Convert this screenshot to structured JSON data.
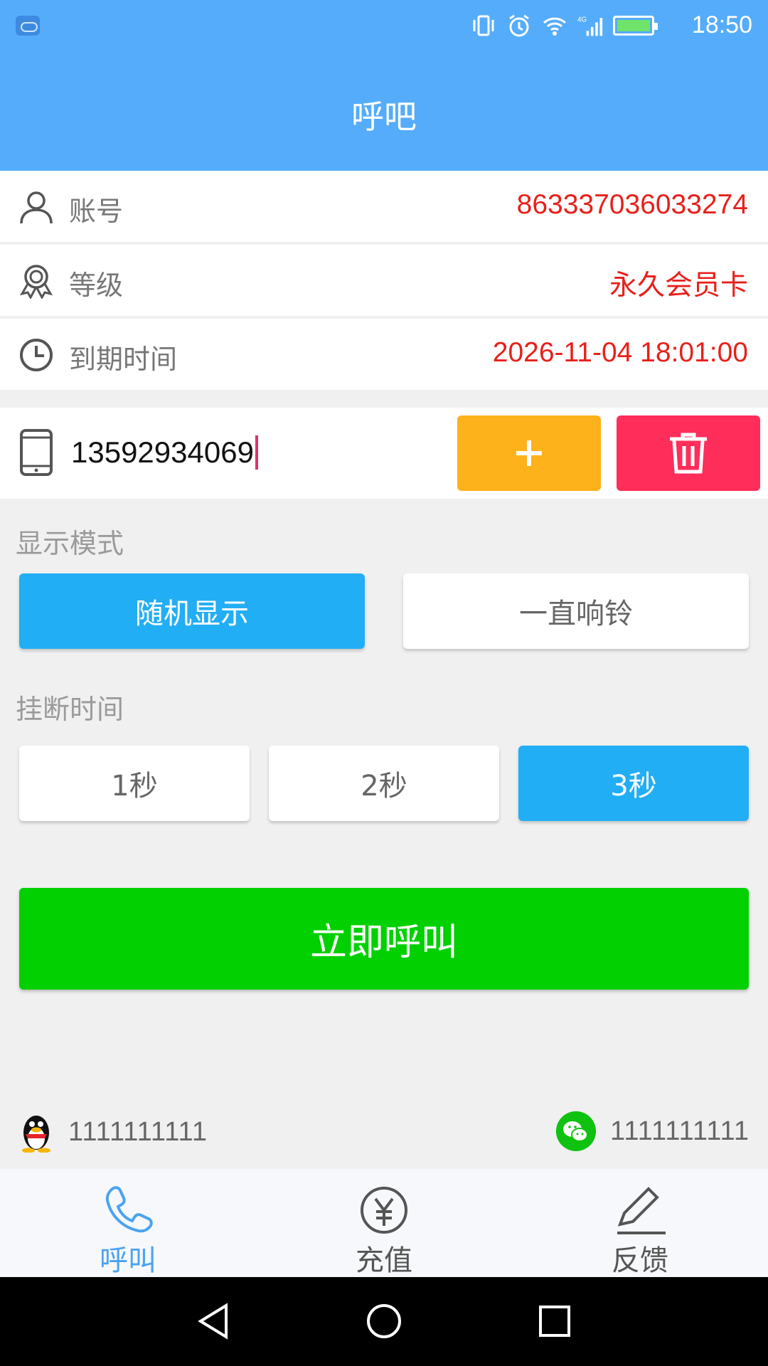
{
  "status_bar": {
    "time": "18:50",
    "network": "4G"
  },
  "header": {
    "title": "呼吧"
  },
  "info": {
    "account": {
      "label": "账号",
      "value": "863337036033274"
    },
    "level": {
      "label": "等级",
      "value": "永久会员卡"
    },
    "expiry": {
      "label": "到期时间",
      "value": "2026-11-04 18:01:00"
    }
  },
  "phone": {
    "value": "13592934069"
  },
  "display_mode": {
    "title": "显示模式",
    "options": [
      "随机显示",
      "一直响铃"
    ],
    "selected": "随机显示"
  },
  "hangup_time": {
    "title": "挂断时间",
    "options": [
      "1秒",
      "2秒",
      "3秒"
    ],
    "selected": "3秒"
  },
  "call_button": {
    "label": "立即呼叫"
  },
  "contacts": {
    "qq": "1111111111",
    "wechat": "1111111111"
  },
  "tabs": [
    {
      "label": "呼叫",
      "icon": "phone-icon",
      "active": true
    },
    {
      "label": "充值",
      "icon": "yuan-coin-icon",
      "active": false
    },
    {
      "label": "反馈",
      "icon": "edit-pen-icon",
      "active": false
    }
  ],
  "colors": {
    "header": "#55acfb",
    "value_red": "#e8201b",
    "add_button": "#fdb11a",
    "delete_button": "#ff2d5a",
    "option_selected": "#22aef5",
    "call_button": "#02d000",
    "tab_active": "#4aa3ef",
    "tab_inactive": "#555555"
  }
}
